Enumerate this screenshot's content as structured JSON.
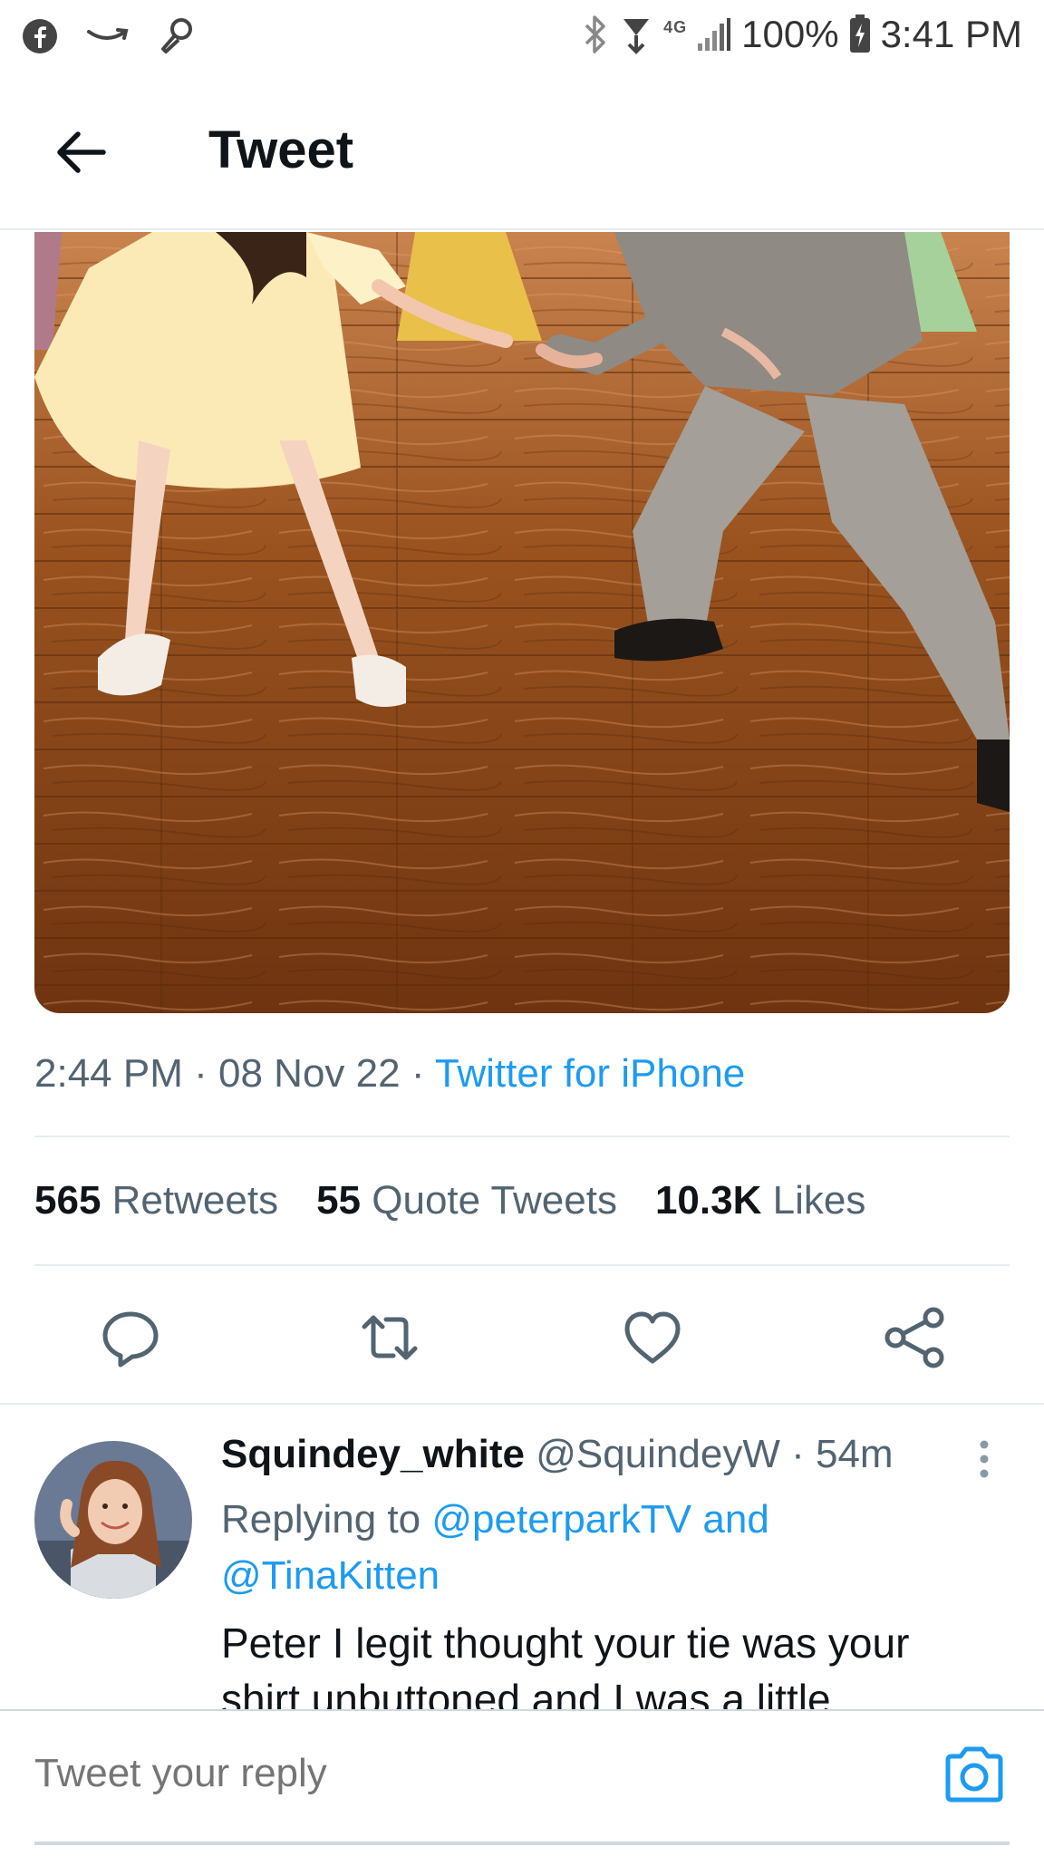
{
  "status_bar": {
    "network": "4G",
    "battery": "100%",
    "time": "3:41 PM",
    "icons": [
      "facebook-icon",
      "amazon-icon",
      "microphone-icon",
      "bluetooth-icon",
      "alarm-icon",
      "signal-icon",
      "battery-icon"
    ]
  },
  "header": {
    "title": "Tweet",
    "back_icon": "arrow-left-icon"
  },
  "tweet": {
    "image_alt": "Couple dancing on a hardwood floor",
    "time": "2:44 PM",
    "date": "08 Nov 22",
    "source": "Twitter for iPhone",
    "stats": {
      "retweets_count": "565",
      "retweets_label": "Retweets",
      "quotes_count": "55",
      "quotes_label": "Quote Tweets",
      "likes_count": "10.3K",
      "likes_label": "Likes"
    },
    "actions": [
      "reply-icon",
      "retweet-icon",
      "like-icon",
      "share-icon"
    ]
  },
  "reply": {
    "display_name": "Squindey_white",
    "handle": "@SquindeyW",
    "time_ago": "54m",
    "replying_label": "Replying to",
    "mention_1": "@peterparkTV and",
    "mention_2": "@TinaKitten",
    "text": "Peter I legit thought your tie was your shirt unbuttoned and I was a little"
  },
  "compose": {
    "placeholder": "Tweet your reply",
    "camera_icon": "camera-icon"
  },
  "colors": {
    "accent": "#1d9bf0",
    "text_primary": "#0f1419",
    "text_secondary": "#536471",
    "divider": "#e6ecf0",
    "floor": "#8a4a1e"
  }
}
